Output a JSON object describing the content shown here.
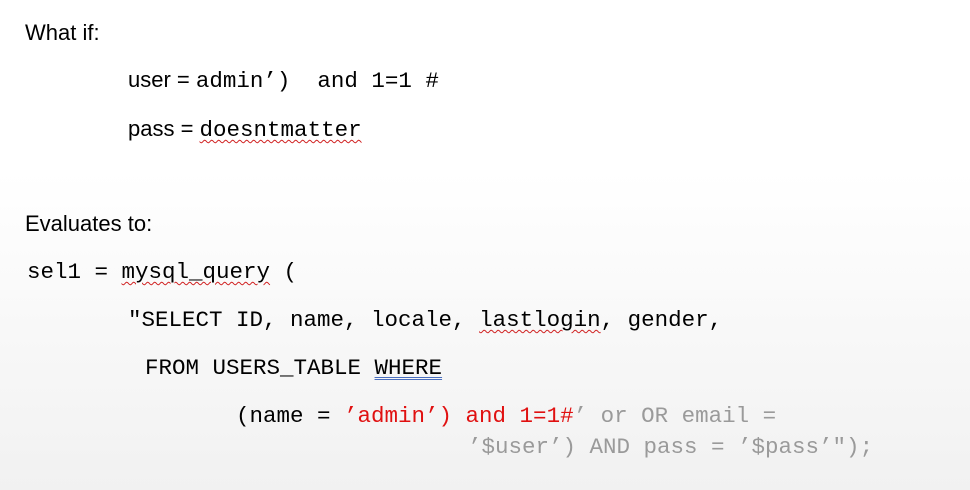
{
  "intro": "What if:",
  "user_line": {
    "label": "user = ",
    "value": "admin’)  and 1=1 #"
  },
  "pass_line": {
    "label": "pass = ",
    "value": "doesntmatter"
  },
  "evaluates": "Evaluates to:",
  "query": {
    "var": "sel1 = ",
    "func": "mysql_query",
    "paren": " (",
    "select_start": "\"SELECT ID, name, locale, ",
    "select_lastlogin": "lastlogin",
    "select_end": ", gender,",
    "from_text": "FROM USERS_TABLE ",
    "where": "WHERE",
    "cond_prefix": "(name = ",
    "cond_red": "’admin’) and 1=1#",
    "cond_grey": "’ or OR email =",
    "cond_cont": "’$user’) AND pass = ’$pass’\");",
    "colors": {
      "injected": "#e01010",
      "commented": "#9a9a9a"
    }
  }
}
